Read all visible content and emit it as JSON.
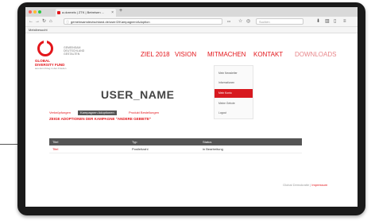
{
  "browser": {
    "tab_title": "a.dormels | ZTK | Betreisen ...",
    "tab_close": "×",
    "new_tab": "+",
    "url": "gemeinsamdeutschland.de/user/2/Kampagnen/Adoption",
    "search_placeholder": "Suchen",
    "bookmark_label": "Meistbesucht",
    "nav_icons": {
      "back": "←",
      "forward": "→",
      "reload": "↻",
      "home": "⌂"
    },
    "toolbar_icons": {
      "more": "•••",
      "star": "☆",
      "pocket": "◎",
      "download": "⬇",
      "library": "▥",
      "sidebar": "▯",
      "menu": "≡"
    }
  },
  "site": {
    "logo_text": "GLOBAL DIVERSITY FUND",
    "logo_sub": "aus dem Krieg in den Frieden",
    "slogan": "GEMEINSAM DEUTSCHLAND GESTALTEN",
    "nav": [
      "ZIEL 2018",
      "VISION",
      "MITMACHEN",
      "KONTAKT",
      "DOWNLOADS"
    ],
    "dropdown": [
      "Mein Newsletter",
      "Informationen",
      "Mein Konto",
      "Meine Gebote",
      "Logout"
    ],
    "dropdown_active_index": 2,
    "username": "USER_NAME",
    "subtabs": [
      "Verknüpfungen",
      "Kampagnen Adoptionen",
      "Produkt Bestellungen"
    ],
    "active_subtab_index": 1,
    "filter_text": "ZEIGE ADOPTIONEN DER KAMPAGNE \"ANDERE GEBIETE\"",
    "table": {
      "headers": [
        "Titel",
        "Typ",
        "Status"
      ],
      "rows": [
        {
          "title": "Titel",
          "type": "Postleitzahl",
          "status": "in Bearbeitung"
        }
      ]
    },
    "footer_text": "Global Demokratie",
    "footer_link": "Impressum"
  },
  "colors": {
    "brand": "#e3161b",
    "header_bg": "#555555",
    "dropdown_active": "#d7191f"
  }
}
